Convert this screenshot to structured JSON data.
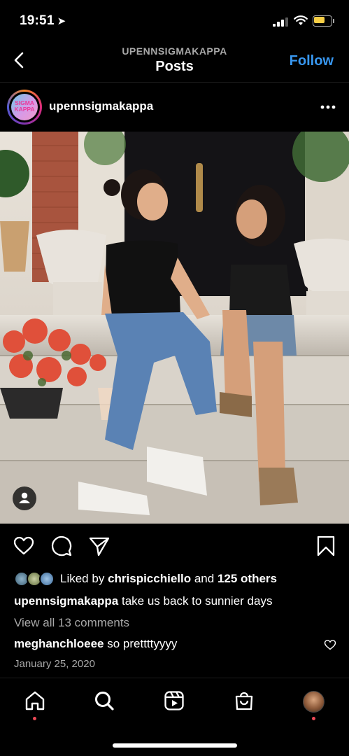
{
  "status_bar": {
    "time": "19:51"
  },
  "header": {
    "account": "UPENNSIGMAKAPPA",
    "title": "Posts",
    "follow_label": "Follow"
  },
  "post": {
    "username": "upennsigmakappa",
    "avatar_text": [
      "SIGMA",
      "KAPPA"
    ],
    "liked_by_prefix": "Liked by",
    "liked_by_user": "chrispicchiello",
    "liked_by_and": "and",
    "liked_by_others": "125 others",
    "caption_user": "upennsigmakappa",
    "caption_text": "take us back to sunnier days",
    "view_comments": "View all 13 comments",
    "comment_user": "meghanchloeee",
    "comment_text": "so prettttyyyy",
    "date": "January 25, 2020"
  },
  "icons": {
    "back": "chevron-left-icon",
    "more": "more-horizontal-icon",
    "like": "heart-icon",
    "comment": "comment-icon",
    "share": "send-icon",
    "save": "bookmark-icon",
    "tag": "user-tag-icon",
    "nav": [
      "home-icon",
      "search-icon",
      "reels-icon",
      "shop-icon",
      "profile-icon"
    ]
  },
  "colors": {
    "accent": "#3897f0",
    "notification": "#ed4956",
    "battery": "#f7ce46"
  }
}
